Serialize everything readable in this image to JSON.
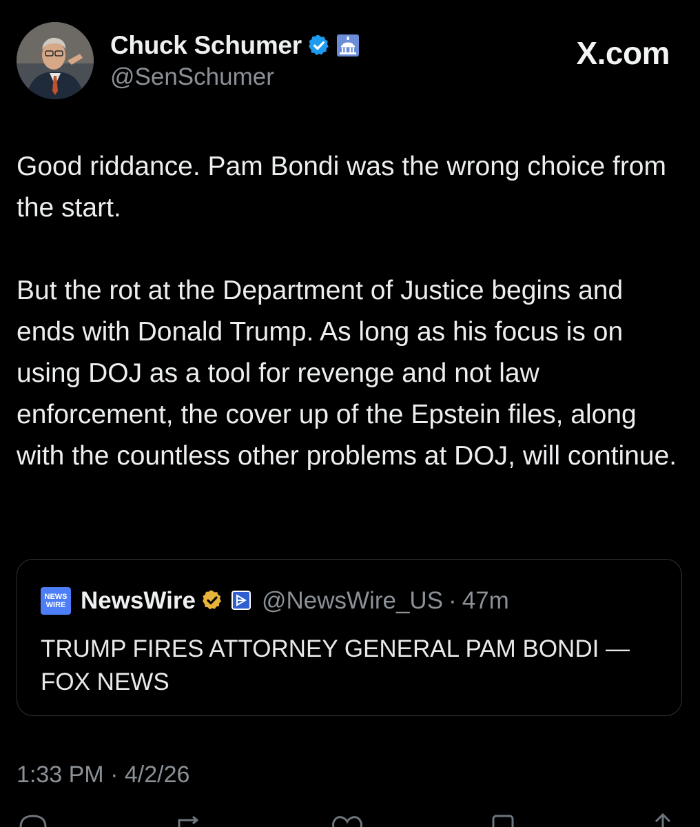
{
  "brand": "X.com",
  "author": {
    "display_name": "Chuck Schumer",
    "handle": "@SenSchumer",
    "badges": [
      "verified-check-icon",
      "capitol-government-icon"
    ]
  },
  "tweet": {
    "paragraph_1": "Good riddance. Pam Bondi was the wrong choice from the start.",
    "paragraph_2": "But the rot at the Department of Justice begins and ends with Donald Trump. As long as his focus is on using DOJ as a tool for revenge and not law enforcement, the cover up of the Epstein files, along with the countless other problems at DOJ, will continue."
  },
  "quote": {
    "logo_line_1": "NEWS",
    "logo_line_2": "WIRE",
    "name": "NewsWire",
    "handle": "@NewsWire_US",
    "separator": "·",
    "time": "47m",
    "text": "TRUMP FIRES ATTORNEY GENERAL PAM BONDI — FOX NEWS"
  },
  "timestamp": {
    "time": "1:33 PM",
    "separator": "·",
    "date": "4/2/26"
  },
  "colors": {
    "background": "#000000",
    "text": "#e7e9ea",
    "secondary_text": "#8b9197",
    "card_border": "#2f3336",
    "verified_blue": "#1d9bf0",
    "verified_gold": "#e8b339",
    "gov_badge_blue": "#6b8cd6"
  },
  "action_bar_icons": [
    "reply-icon",
    "repost-icon",
    "like-icon",
    "bookmark-icon",
    "share-icon"
  ]
}
